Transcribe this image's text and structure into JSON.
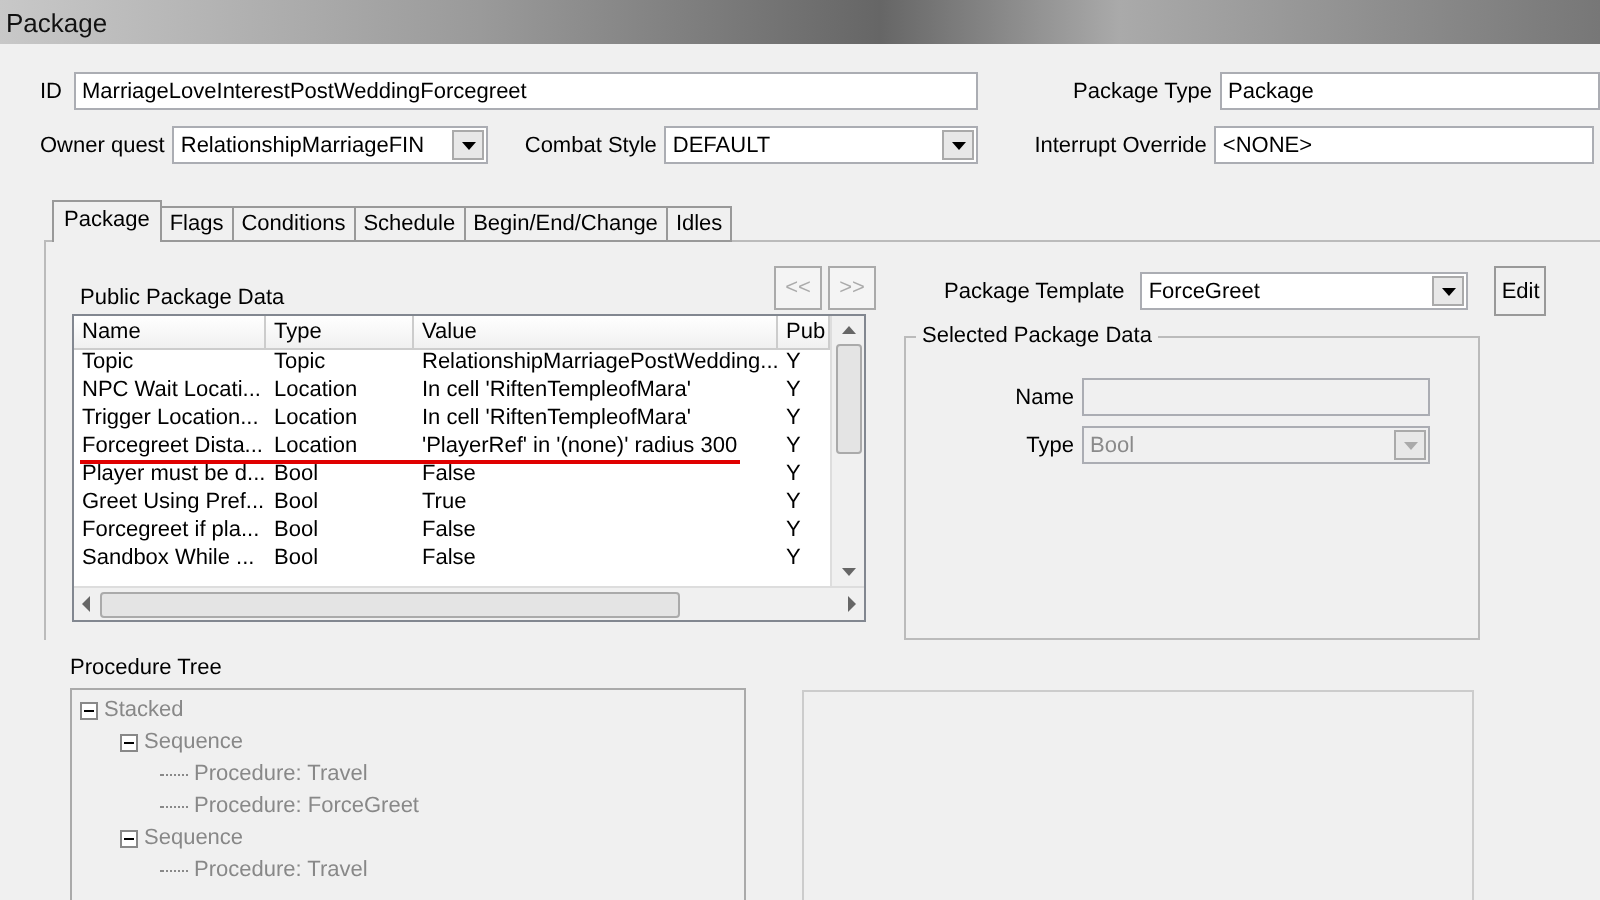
{
  "window": {
    "title": "Package"
  },
  "id": {
    "label": "ID",
    "value": "MarriageLoveInterestPostWeddingForcegreet"
  },
  "package_type": {
    "label": "Package Type",
    "value": "Package"
  },
  "owner_quest": {
    "label": "Owner quest",
    "value": "RelationshipMarriageFIN"
  },
  "combat_style": {
    "label": "Combat Style",
    "value": "DEFAULT"
  },
  "interrupt_override": {
    "label": "Interrupt Override",
    "value": "<NONE>"
  },
  "tabs": [
    {
      "label": "Package",
      "selected": true
    },
    {
      "label": "Flags",
      "selected": false
    },
    {
      "label": "Conditions",
      "selected": false
    },
    {
      "label": "Schedule",
      "selected": false
    },
    {
      "label": "Begin/End/Change",
      "selected": false
    },
    {
      "label": "Idles",
      "selected": false
    }
  ],
  "public_data": {
    "title": "Public Package Data",
    "prev_button": "<<",
    "next_button": ">>",
    "columns": [
      "Name",
      "Type",
      "Value",
      "Pub"
    ],
    "rows": [
      {
        "cells": [
          "Topic",
          "Topic",
          "RelationshipMarriagePostWedding...",
          "Y"
        ],
        "underlined": false
      },
      {
        "cells": [
          "NPC Wait Locati...",
          "Location",
          "In cell 'RiftenTempleofMara'",
          "Y"
        ],
        "underlined": false
      },
      {
        "cells": [
          "Trigger Location...",
          "Location",
          "In cell 'RiftenTempleofMara'",
          "Y"
        ],
        "underlined": false
      },
      {
        "cells": [
          "Forcegreet Dista...",
          "Location",
          "'PlayerRef' in '(none)' radius 300",
          "Y"
        ],
        "underlined": true
      },
      {
        "cells": [
          "Player must be d...",
          "Bool",
          "False",
          "Y"
        ],
        "underlined": false
      },
      {
        "cells": [
          "Greet Using Pref...",
          "Bool",
          "True",
          "Y"
        ],
        "underlined": false
      },
      {
        "cells": [
          "Forcegreet if pla...",
          "Bool",
          "False",
          "Y"
        ],
        "underlined": false
      },
      {
        "cells": [
          "Sandbox While ...",
          "Bool",
          "False",
          "Y"
        ],
        "underlined": false
      }
    ]
  },
  "package_template": {
    "label": "Package Template",
    "value": "ForceGreet",
    "edit_button": "Edit"
  },
  "selected_data": {
    "title": "Selected Package Data",
    "name_label": "Name",
    "type_label": "Type",
    "type_value": "Bool",
    "disabled": true
  },
  "procedure_tree": {
    "title": "Procedure Tree",
    "disabled": true,
    "items": [
      {
        "label": "Stacked",
        "expanded": true,
        "children": [
          {
            "label": "Sequence",
            "expanded": true,
            "children": [
              {
                "label": "Procedure: Travel"
              },
              {
                "label": "Procedure: ForceGreet"
              }
            ]
          },
          {
            "label": "Sequence",
            "expanded": true,
            "children": [
              {
                "label": "Procedure: Travel"
              }
            ]
          }
        ]
      }
    ]
  }
}
